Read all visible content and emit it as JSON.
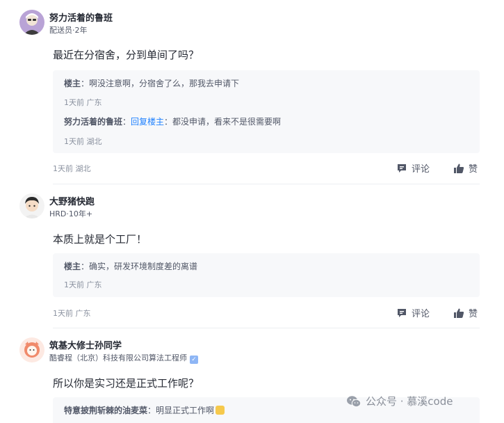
{
  "comments": [
    {
      "author": "努力活着的鲁班",
      "meta": "配送员·2年",
      "body": "最近在分宿舍，分到单间了吗？",
      "replies": [
        {
          "author": "楼主",
          "text": "：啊没注意啊，分宿舍了么，那我去申请下",
          "meta": "1天前 广东"
        },
        {
          "author": "努力活着的鲁班",
          "link": "回复楼主",
          "text": "：都没申请，看来不是很需要啊",
          "meta": "1天前 湖北"
        }
      ],
      "foot_meta": "1天前 湖北",
      "comment_label": "评论",
      "like_label": "赞"
    },
    {
      "author": "大野猪快跑",
      "meta": "HRD·10年+",
      "body": "本质上就是个工厂！",
      "replies": [
        {
          "author": "楼主",
          "text": "：确实，研发环境制度差的离谱",
          "meta": "1天前 广东"
        }
      ],
      "foot_meta": "1天前 广东",
      "comment_label": "评论",
      "like_label": "赞"
    },
    {
      "author": "筑基大修士孙同学",
      "meta": "酷睿程（北京）科技有限公司算法工程师",
      "body": "所以你是实习还是正式工作呢？",
      "replies": [
        {
          "author": "特意披荆斩棘的油麦菜",
          "text": "：明显正式工作啊"
        }
      ]
    }
  ],
  "watermark": "公众号 · 慕溪code",
  "icons": {
    "comment": "comment-icon",
    "like": "thumbs-up-icon",
    "verified": "verified-badge-icon",
    "wechat": "wechat-icon"
  }
}
